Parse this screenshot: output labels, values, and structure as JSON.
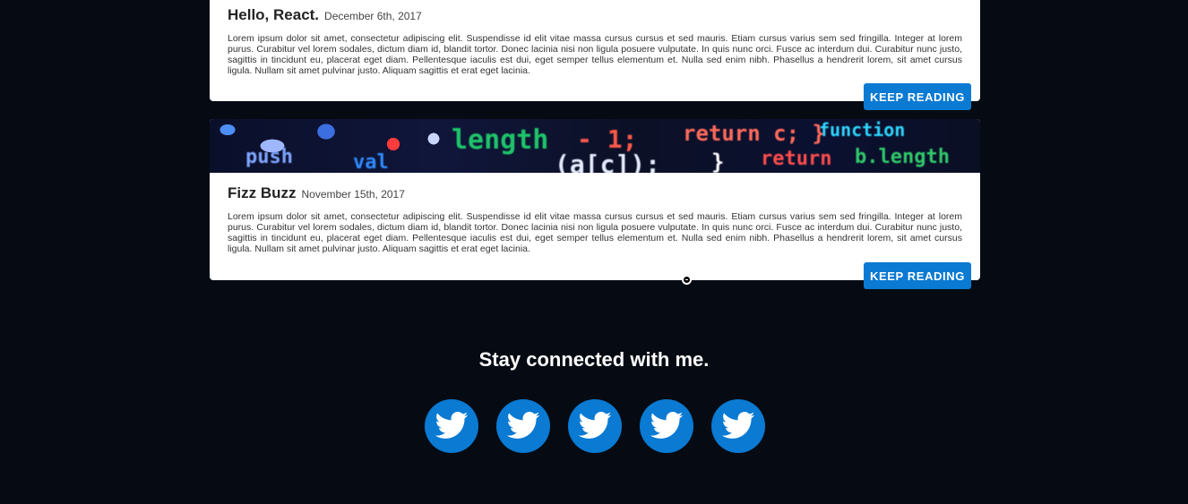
{
  "posts": [
    {
      "title": "Hello, React.",
      "date": "December 6th, 2017",
      "excerpt": "Lorem ipsum dolor sit amet, consectetur adipiscing elit. Suspendisse id elit vitae massa cursus cursus et sed mauris. Etiam cursus varius sem sed fringilla. Integer at lorem purus. Curabitur vel lorem sodales, dictum diam id, blandit tortor. Donec lacinia nisi non ligula posuere vulputate. In quis nunc orci. Fusce ac interdum dui. Curabitur nunc justo, sagittis in tincidunt eu, placerat eget diam. Pellentesque iaculis est dui, eget semper tellus elementum et. Nulla sed enim nibh. Phasellus a hendrerit lorem, sit amet cursus ligula. Nullam sit amet pulvinar justo. Aliquam sagittis et erat eget lacinia.",
      "button_label": "KEEP READING"
    },
    {
      "title": "Fizz Buzz",
      "date": "November 15th, 2017",
      "excerpt": "Lorem ipsum dolor sit amet, consectetur adipiscing elit. Suspendisse id elit vitae massa cursus cursus et sed mauris. Etiam cursus varius sem sed fringilla. Integer at lorem purus. Curabitur vel lorem sodales, dictum diam id, blandit tortor. Donec lacinia nisi non ligula posuere vulputate. In quis nunc orci. Fusce ac interdum dui. Curabitur nunc justo, sagittis in tincidunt eu, placerat eget diam. Pellentesque iaculis est dui, eget semper tellus elementum et. Nulla sed enim nibh. Phasellus a hendrerit lorem, sit amet cursus ligula. Nullam sit amet pulvinar justo. Aliquam sagittis et erat eget lacinia.",
      "button_label": "KEEP READING",
      "banner": {
        "icon": "code-banner-image",
        "tokens": [
          "length",
          "- 1;",
          "return c; }",
          "function",
          "(a[c]);",
          "}",
          "return",
          "b.length",
          "val",
          "push"
        ]
      }
    }
  ],
  "footer": {
    "title": "Stay connected with me.",
    "social_icons": [
      "twitter-icon",
      "twitter-icon",
      "twitter-icon",
      "twitter-icon",
      "twitter-icon"
    ]
  },
  "colors": {
    "background": "#060b13",
    "accent": "#0a7ad3",
    "card": "#ffffff"
  }
}
